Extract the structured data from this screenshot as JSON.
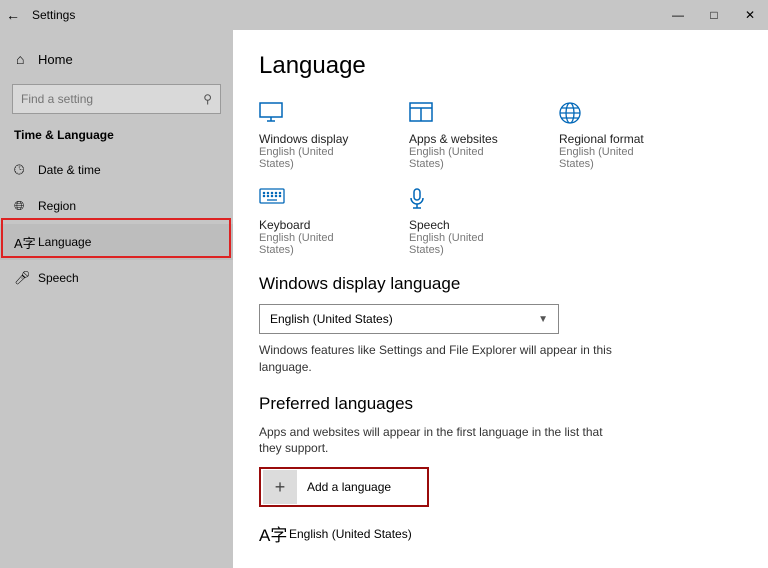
{
  "titlebar": {
    "label": "Settings"
  },
  "sidebar": {
    "home": "Home",
    "search_placeholder": "Find a setting",
    "category": "Time & Language",
    "items": [
      {
        "label": "Date & time"
      },
      {
        "label": "Region"
      },
      {
        "label": "Language"
      },
      {
        "label": "Speech"
      }
    ]
  },
  "page": {
    "title": "Language",
    "tiles": [
      {
        "title": "Windows display",
        "sub": "English (United States)"
      },
      {
        "title": "Apps & websites",
        "sub": "English (United States)"
      },
      {
        "title": "Regional format",
        "sub": "English (United States)"
      },
      {
        "title": "Keyboard",
        "sub": "English (United States)"
      },
      {
        "title": "Speech",
        "sub": "English (United States)"
      }
    ],
    "display_section": {
      "heading": "Windows display language",
      "selected": "English (United States)",
      "desc": "Windows features like Settings and File Explorer will appear in this language."
    },
    "preferred": {
      "heading": "Preferred languages",
      "desc": "Apps and websites will appear in the first language in the list that they support.",
      "add": "Add a language",
      "lang": "English (United States)"
    }
  }
}
